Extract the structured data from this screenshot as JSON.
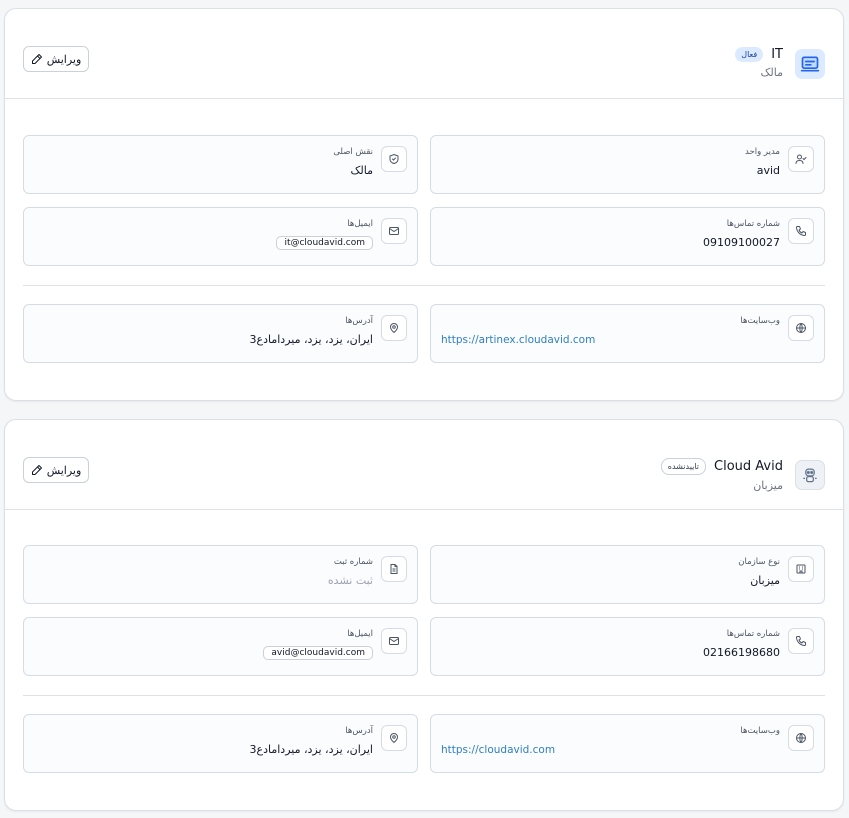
{
  "cards": [
    {
      "title": "IT",
      "badge": "فعال",
      "subtitle": "مالک",
      "edit_label": "ویرایش",
      "avatar_icon": "laptop-icon",
      "fields": {
        "manager": {
          "label": "مدیر واحد",
          "value": "avid"
        },
        "main_role": {
          "label": "نقش اصلی",
          "value": "مالک"
        },
        "phone": {
          "label": "شماره تماس‌ها",
          "value": "09109100027"
        },
        "email": {
          "label": "ایمیل‌ها",
          "value": "it@cloudavid.com"
        },
        "website": {
          "label": "وب‌سایت‌ها",
          "value": "https://artinex.cloudavid.com"
        },
        "address": {
          "label": "آدرس‌ها",
          "value": "ایران، یزد، یزد، میردامادع3"
        }
      }
    },
    {
      "title": "Cloud Avid",
      "badge": "تاییدنشده",
      "subtitle": "میزبان",
      "edit_label": "ویرایش",
      "avatar_icon": "robot-icon",
      "fields": {
        "org_type": {
          "label": "نوع سازمان",
          "value": "میزبان"
        },
        "registration": {
          "label": "شماره ثبت",
          "value": "ثبت نشده"
        },
        "phone": {
          "label": "شماره تماس‌ها",
          "value": "02166198680"
        },
        "email": {
          "label": "ایمیل‌ها",
          "value": "avid@cloudavid.com"
        },
        "website": {
          "label": "وب‌سایت‌ها",
          "value": "https://cloudavid.com"
        },
        "address": {
          "label": "آدرس‌ها",
          "value": "ایران، یزد، یزد، میردامادع3"
        }
      }
    }
  ],
  "colors": {
    "link": "#2f7fc1",
    "active_badge_bg": "#dbeafe",
    "border": "#d5dde4"
  }
}
